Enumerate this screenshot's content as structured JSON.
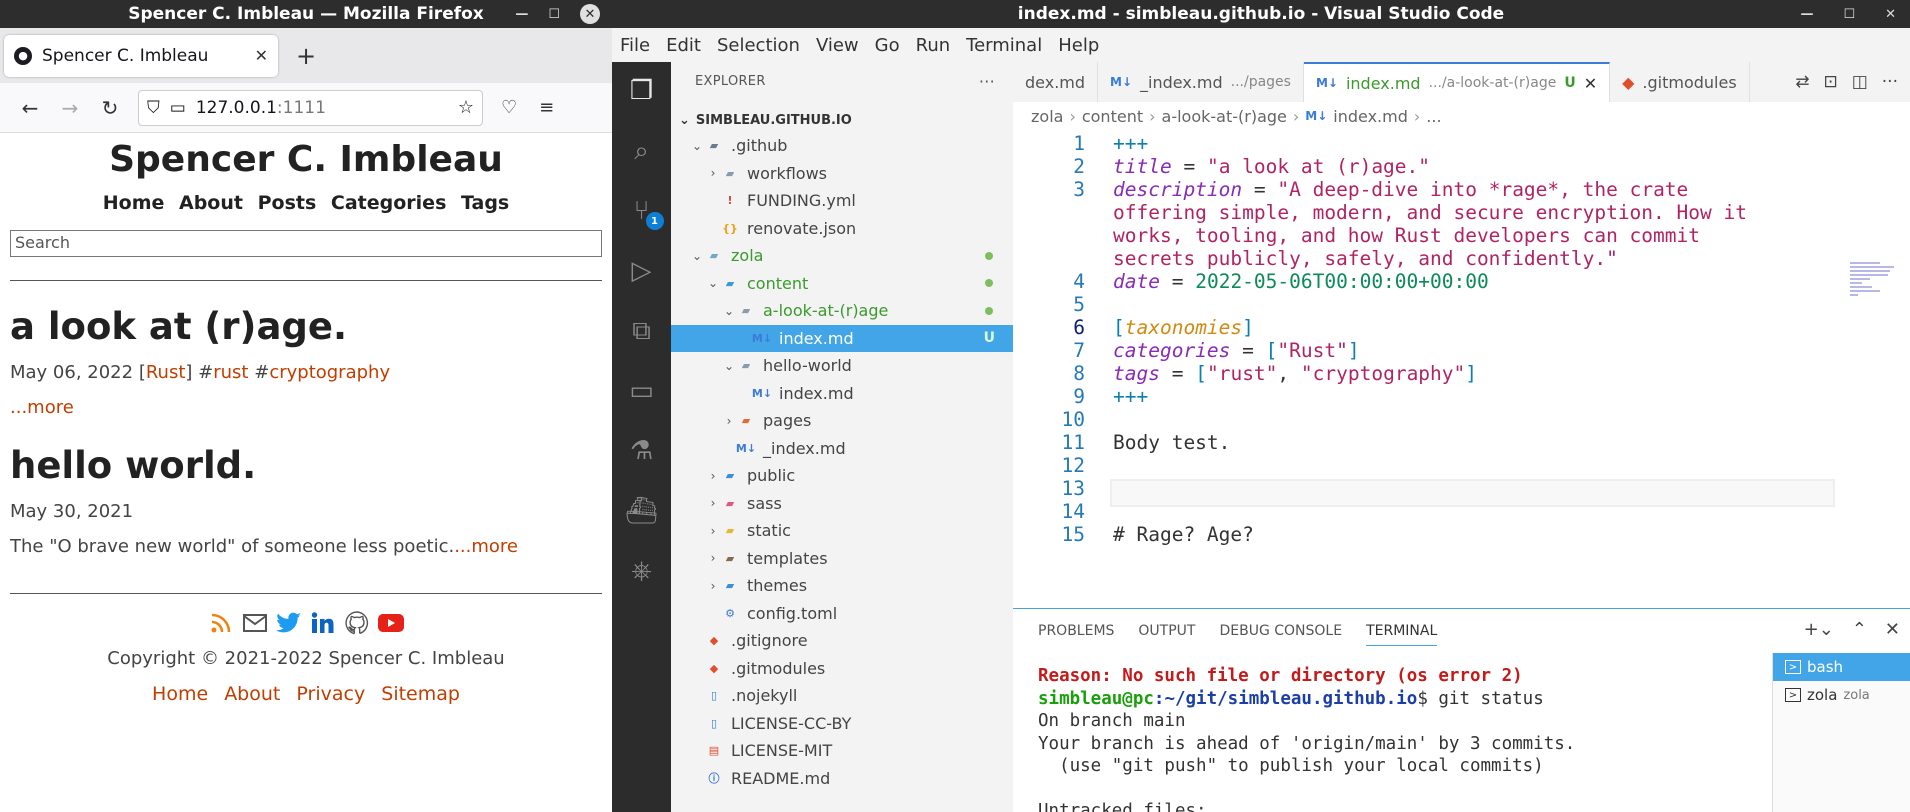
{
  "firefox": {
    "window_title": "Spencer C. Imbleau — Mozilla Firefox",
    "tab_title": "Spencer C. Imbleau",
    "url_host": "127.0.0.1",
    "url_port": ":1111",
    "site": {
      "title": "Spencer C. Imbleau",
      "nav": [
        "Home",
        "About",
        "Posts",
        "Categories",
        "Tags"
      ],
      "search_placeholder": "Search",
      "posts": [
        {
          "title": "a look at (r)age.",
          "date": "May 06, 2022",
          "category": "Rust",
          "tags": [
            "#rust",
            "#cryptography"
          ],
          "more": "...more"
        },
        {
          "title": "hello world.",
          "date": "May 30, 2021",
          "excerpt": "The \"O brave new world\" of someone less poetic.",
          "more": "...more"
        }
      ],
      "copyright": "Copyright © 2021-2022 Spencer C. Imbleau",
      "footer_links": [
        "Home",
        "About",
        "Privacy",
        "Sitemap"
      ],
      "footer_icons": [
        "rss-icon",
        "email-icon",
        "twitter-icon",
        "linkedin-icon",
        "github-icon",
        "youtube-icon"
      ]
    }
  },
  "vscode": {
    "window_title": "index.md - simbleau.github.io - Visual Studio Code",
    "menu": [
      "File",
      "Edit",
      "Selection",
      "View",
      "Go",
      "Run",
      "Terminal",
      "Help"
    ],
    "explorer_title": "EXPLORER",
    "root": "SIMBLEAU.GITHUB.IO",
    "scm_badge": "1",
    "tree": [
      {
        "label": ".github",
        "depth": 0,
        "type": "folder",
        "open": true
      },
      {
        "label": "workflows",
        "depth": 1,
        "type": "folder",
        "open": false
      },
      {
        "label": "FUNDING.yml",
        "depth": 1,
        "type": "yml"
      },
      {
        "label": "renovate.json",
        "depth": 1,
        "type": "json"
      },
      {
        "label": "zola",
        "depth": 0,
        "type": "folder",
        "open": true,
        "status": "dot"
      },
      {
        "label": "content",
        "depth": 1,
        "type": "folder",
        "open": true,
        "status": "dot"
      },
      {
        "label": "a-look-at-(r)age",
        "depth": 2,
        "type": "folder",
        "open": true,
        "status": "dot"
      },
      {
        "label": "index.md",
        "depth": 3,
        "type": "md",
        "status": "U",
        "selected": true
      },
      {
        "label": "hello-world",
        "depth": 2,
        "type": "folder",
        "open": true
      },
      {
        "label": "index.md",
        "depth": 3,
        "type": "md"
      },
      {
        "label": "pages",
        "depth": 2,
        "type": "folder",
        "open": false
      },
      {
        "label": "_index.md",
        "depth": 2,
        "type": "md"
      },
      {
        "label": "public",
        "depth": 1,
        "type": "folder",
        "open": false
      },
      {
        "label": "sass",
        "depth": 1,
        "type": "folder",
        "open": false
      },
      {
        "label": "static",
        "depth": 1,
        "type": "folder",
        "open": false
      },
      {
        "label": "templates",
        "depth": 1,
        "type": "folder",
        "open": false
      },
      {
        "label": "themes",
        "depth": 1,
        "type": "folder",
        "open": false
      },
      {
        "label": "config.toml",
        "depth": 1,
        "type": "config"
      },
      {
        "label": ".gitignore",
        "depth": 0,
        "type": "git"
      },
      {
        "label": ".gitmodules",
        "depth": 0,
        "type": "git"
      },
      {
        "label": ".nojekyll",
        "depth": 0,
        "type": "file"
      },
      {
        "label": "LICENSE-CC-BY",
        "depth": 0,
        "type": "file"
      },
      {
        "label": "LICENSE-MIT",
        "depth": 0,
        "type": "license"
      },
      {
        "label": "README.md",
        "depth": 0,
        "type": "info"
      }
    ],
    "tabs": [
      {
        "label": "dex.md",
        "desc": ""
      },
      {
        "label": "_index.md",
        "desc": ".../pages"
      },
      {
        "label": "index.md",
        "desc": ".../a-look-at-(r)age",
        "active": true,
        "status": "U"
      },
      {
        "label": ".gitmodules",
        "desc": ""
      }
    ],
    "breadcrumb": [
      "zola",
      "content",
      "a-look-at-(r)age",
      "index.md",
      "..."
    ],
    "panel_tabs": [
      "PROBLEMS",
      "OUTPUT",
      "DEBUG CONSOLE",
      "TERMINAL"
    ],
    "terminal": {
      "line1": "Reason: No such file or directory (os error 2)",
      "prompt_user": "simbleau@pc",
      "prompt_path": ":~/git/simbleau.github.io",
      "prompt_cmd": "$ git status",
      "line3": "On branch main",
      "line4": "Your branch is ahead of 'origin/main' by 3 commits.",
      "line5": "  (use \"git push\" to publish your local commits)",
      "line6": "",
      "line7": "Untracked files:"
    },
    "terminals": [
      {
        "name": "bash",
        "sub": ""
      },
      {
        "name": "zola",
        "sub": "zola"
      }
    ]
  }
}
